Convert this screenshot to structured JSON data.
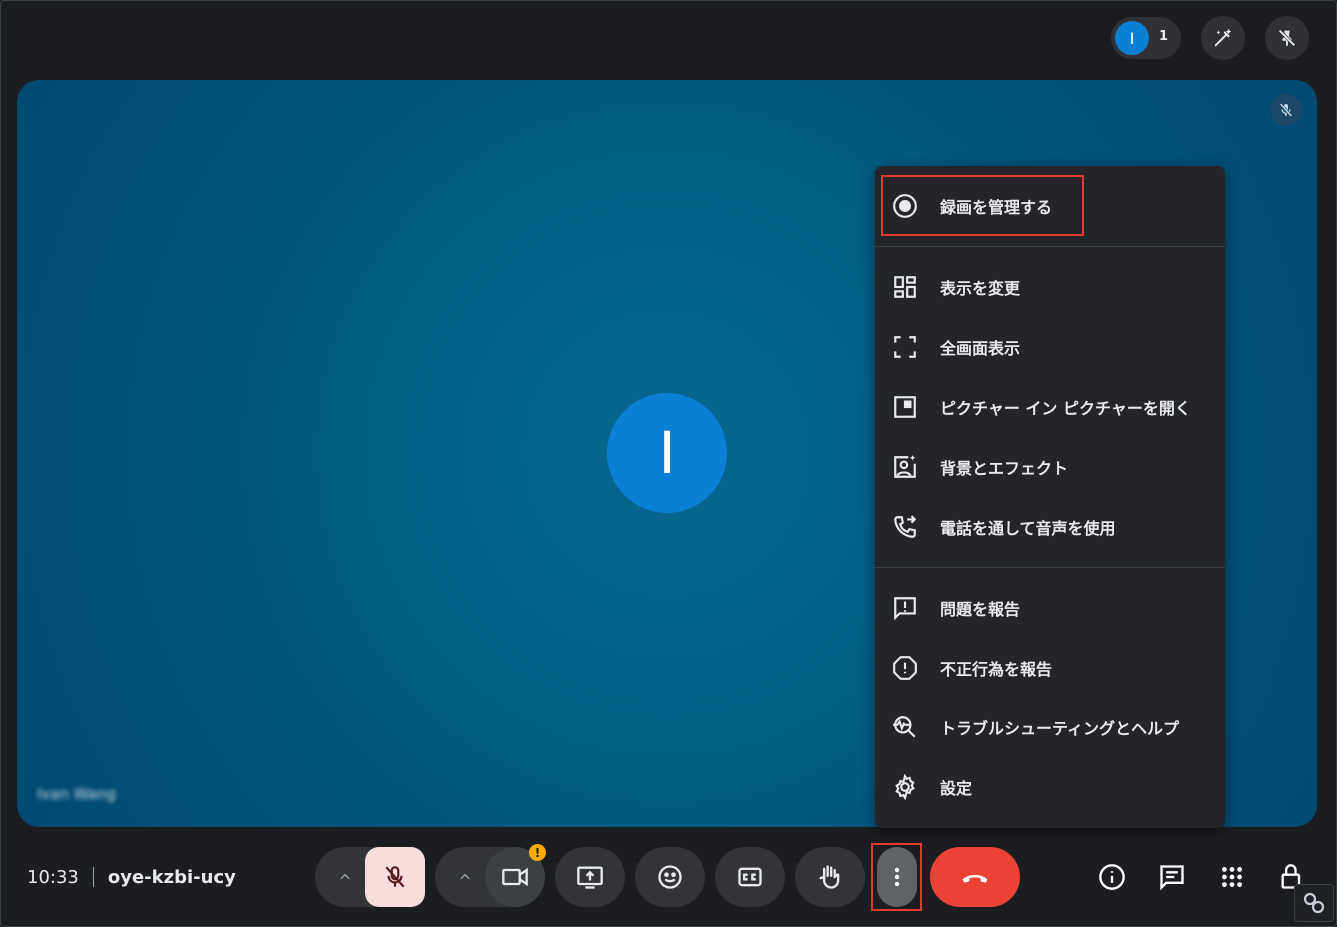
{
  "top_bar": {
    "participant_initial": "I",
    "participant_count": "1",
    "icons": [
      "edit-sparkle-icon",
      "pin-off-icon"
    ]
  },
  "stage": {
    "avatar_initial": "I",
    "participant_name_blurred": "Ivan Wang",
    "muted_icon": "mic-off-icon"
  },
  "menu": {
    "items": [
      {
        "label": "録画を管理する",
        "icon": "record-icon"
      },
      {
        "label": "表示を変更",
        "icon": "layout-icon"
      },
      {
        "label": "全画面表示",
        "icon": "fullscreen-icon"
      },
      {
        "label": "ピクチャー イン ピクチャーを開く",
        "icon": "picture-in-picture-icon"
      },
      {
        "label": "背景とエフェクト",
        "icon": "background-effects-icon"
      },
      {
        "label": "電話を通して音声を使用",
        "icon": "phone-forward-icon"
      },
      {
        "label": "問題を報告",
        "icon": "feedback-icon"
      },
      {
        "label": "不正行為を報告",
        "icon": "report-abuse-icon"
      },
      {
        "label": "トラブルシューティングとヘルプ",
        "icon": "troubleshoot-icon"
      },
      {
        "label": "設定",
        "icon": "settings-icon"
      }
    ]
  },
  "bottom_bar": {
    "time": "10:33",
    "meeting_code": "oye-kzbi-ucy",
    "camera_warning": "!",
    "controls": [
      "mic-options",
      "mic-off",
      "camera-options",
      "camera",
      "present",
      "reactions",
      "captions",
      "raise-hand",
      "more-options",
      "leave-call"
    ],
    "right_icons": [
      "info-icon",
      "chat-icon",
      "activities-icon",
      "host-controls-icon"
    ]
  },
  "colors": {
    "background": "#1c1d20",
    "stage": "#05618a",
    "avatar": "#0b7fd4",
    "end_call": "#ea4335",
    "mic_off_bg": "#f9dedc",
    "highlight": "#e53935",
    "warning": "#f9ab00"
  }
}
